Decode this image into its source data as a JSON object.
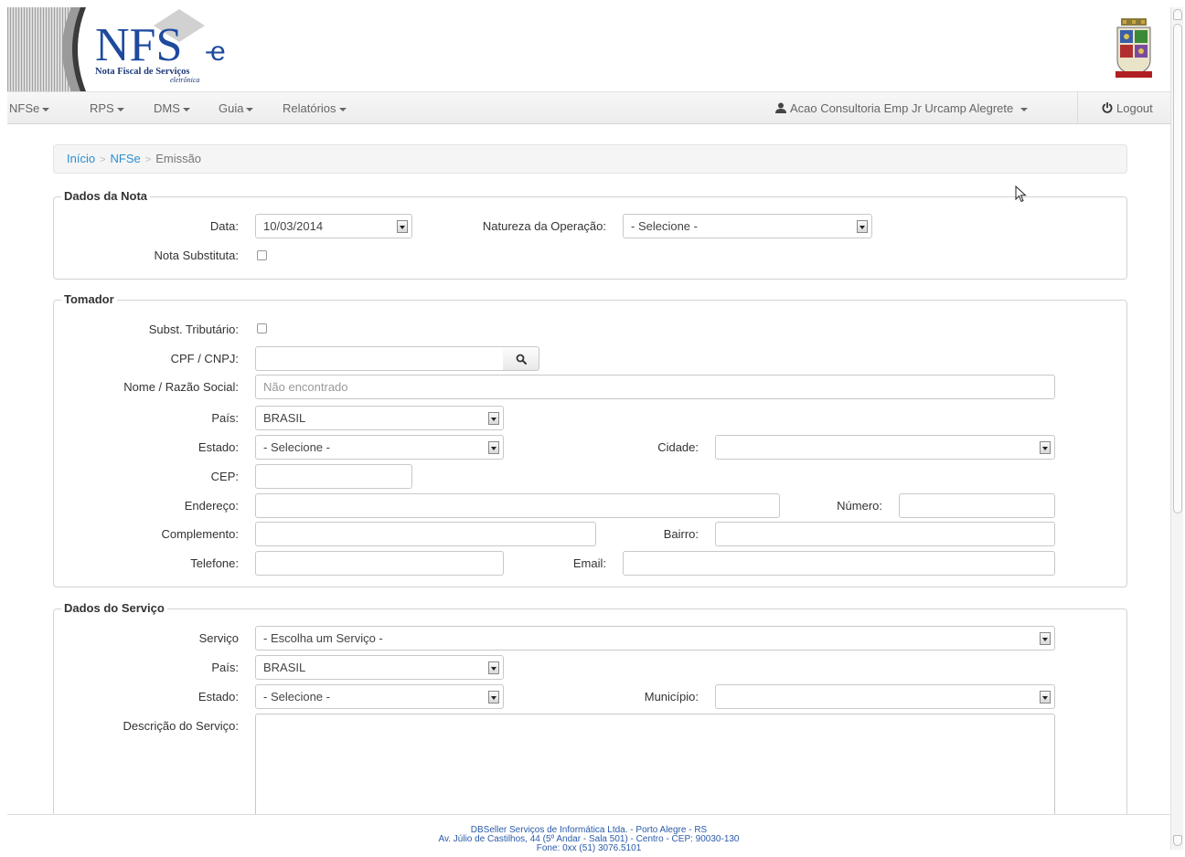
{
  "header": {
    "logo_title": "NFS",
    "logo_suffix": "e",
    "logo_subtitle": "Nota Fiscal de Serviços",
    "logo_sub2": "eletrônica"
  },
  "nav": {
    "items": [
      {
        "label": "NFSe"
      },
      {
        "label": "RPS"
      },
      {
        "label": "DMS"
      },
      {
        "label": "Guia"
      },
      {
        "label": "Relatórios"
      }
    ],
    "user": "Acao Consultoria Emp Jr Urcamp Alegrete",
    "logout": "Logout"
  },
  "breadcrumb": {
    "home": "Início",
    "nfse": "NFSe",
    "current": "Emissão",
    "separator": ">"
  },
  "dados_nota": {
    "legend": "Dados da Nota",
    "data_label": "Data:",
    "data_value": "10/03/2014",
    "natureza_label": "Natureza da Operação:",
    "natureza_value": "- Selecione -",
    "substituta_label": "Nota Substituta:"
  },
  "tomador": {
    "legend": "Tomador",
    "subst_label": "Subst. Tributário:",
    "cpf_label": "CPF / CNPJ:",
    "cpf_value": "",
    "nome_label": "Nome / Razão Social:",
    "nome_placeholder": "Não encontrado",
    "pais_label": "País:",
    "pais_value": "BRASIL",
    "estado_label": "Estado:",
    "estado_value": "- Selecione -",
    "cidade_label": "Cidade:",
    "cidade_value": "",
    "cep_label": "CEP:",
    "endereco_label": "Endereço:",
    "numero_label": "Número:",
    "complemento_label": "Complemento:",
    "bairro_label": "Bairro:",
    "telefone_label": "Telefone:",
    "email_label": "Email:"
  },
  "servico": {
    "legend": "Dados do Serviço",
    "servico_label": "Serviço",
    "servico_value": "- Escolha um Serviço -",
    "pais_label": "País:",
    "pais_value": "BRASIL",
    "estado_label": "Estado:",
    "estado_value": "- Selecione -",
    "municipio_label": "Município:",
    "municipio_value": "",
    "descricao_label": "Descrição do Serviço:"
  },
  "footer": {
    "line1": "DBSeller Serviços de Informática Ltda. - Porto Alegre - RS",
    "line2": "Av. Júlio de Castilhos, 44 (5º Andar - Sala 501) - Centro - CEP: 90030-130",
    "line3": "Fone: 0xx (51) 3076.5101"
  },
  "colors": {
    "link": "#2a8fd1",
    "logo_blue": "#1e4a9e",
    "footer_text": "#2a5aa8"
  }
}
